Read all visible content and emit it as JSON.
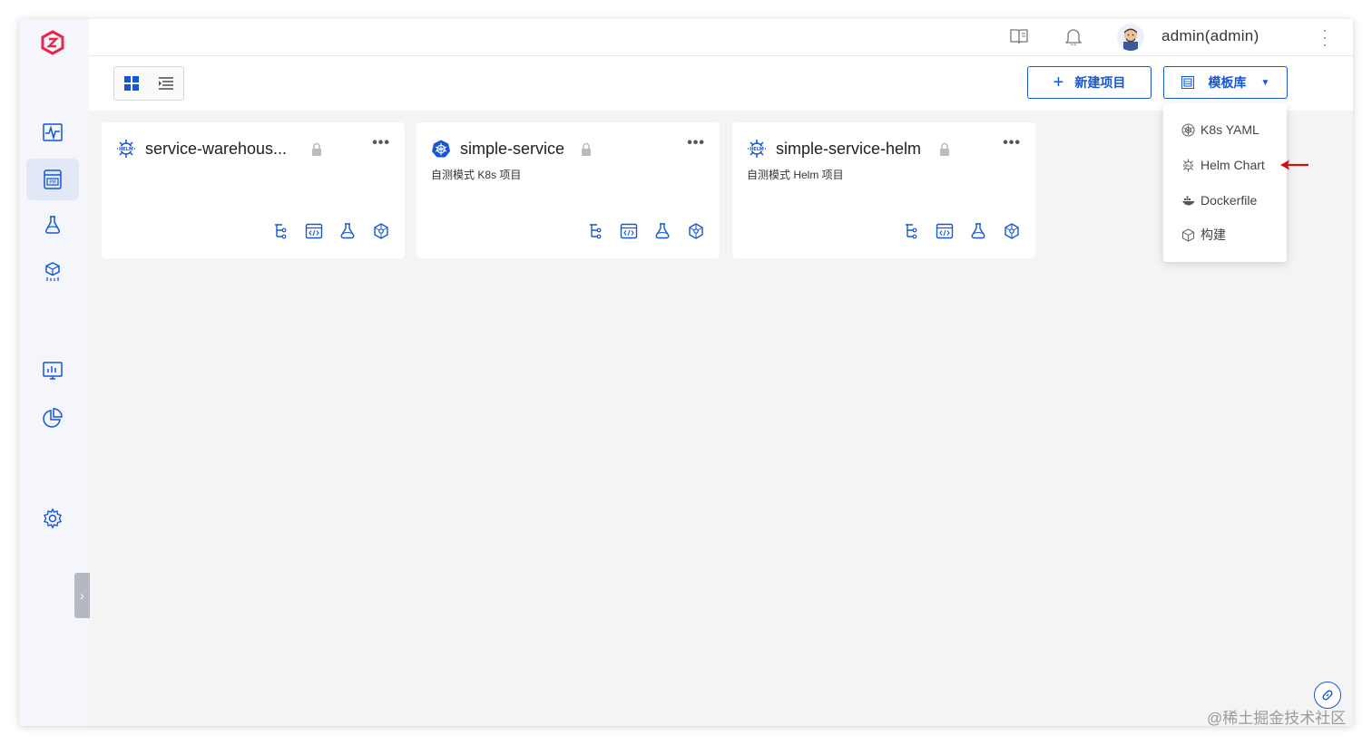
{
  "header": {
    "username": "admin(admin)"
  },
  "toolbar": {
    "new_project_label": "新建项目",
    "template_label": "模板库"
  },
  "projects": [
    {
      "name": "service-warehous...",
      "description": "",
      "icon": "helm-icon"
    },
    {
      "name": "simple-service",
      "description": "自测模式 K8s 项目",
      "icon": "kubernetes-icon"
    },
    {
      "name": "simple-service-helm",
      "description": "自测模式 Helm 项目",
      "icon": "helm-icon"
    }
  ],
  "template_menu": [
    {
      "label": "K8s YAML",
      "icon": "kubernetes-icon"
    },
    {
      "label": "Helm Chart",
      "icon": "helm-icon"
    },
    {
      "label": "Dockerfile",
      "icon": "docker-icon"
    },
    {
      "label": "构建",
      "icon": "cube-icon"
    }
  ],
  "colors": {
    "accent": "#1456d6",
    "logo": "#e8254a",
    "arrow": "#cc1111"
  },
  "watermark": "@稀土掘金技术社区"
}
